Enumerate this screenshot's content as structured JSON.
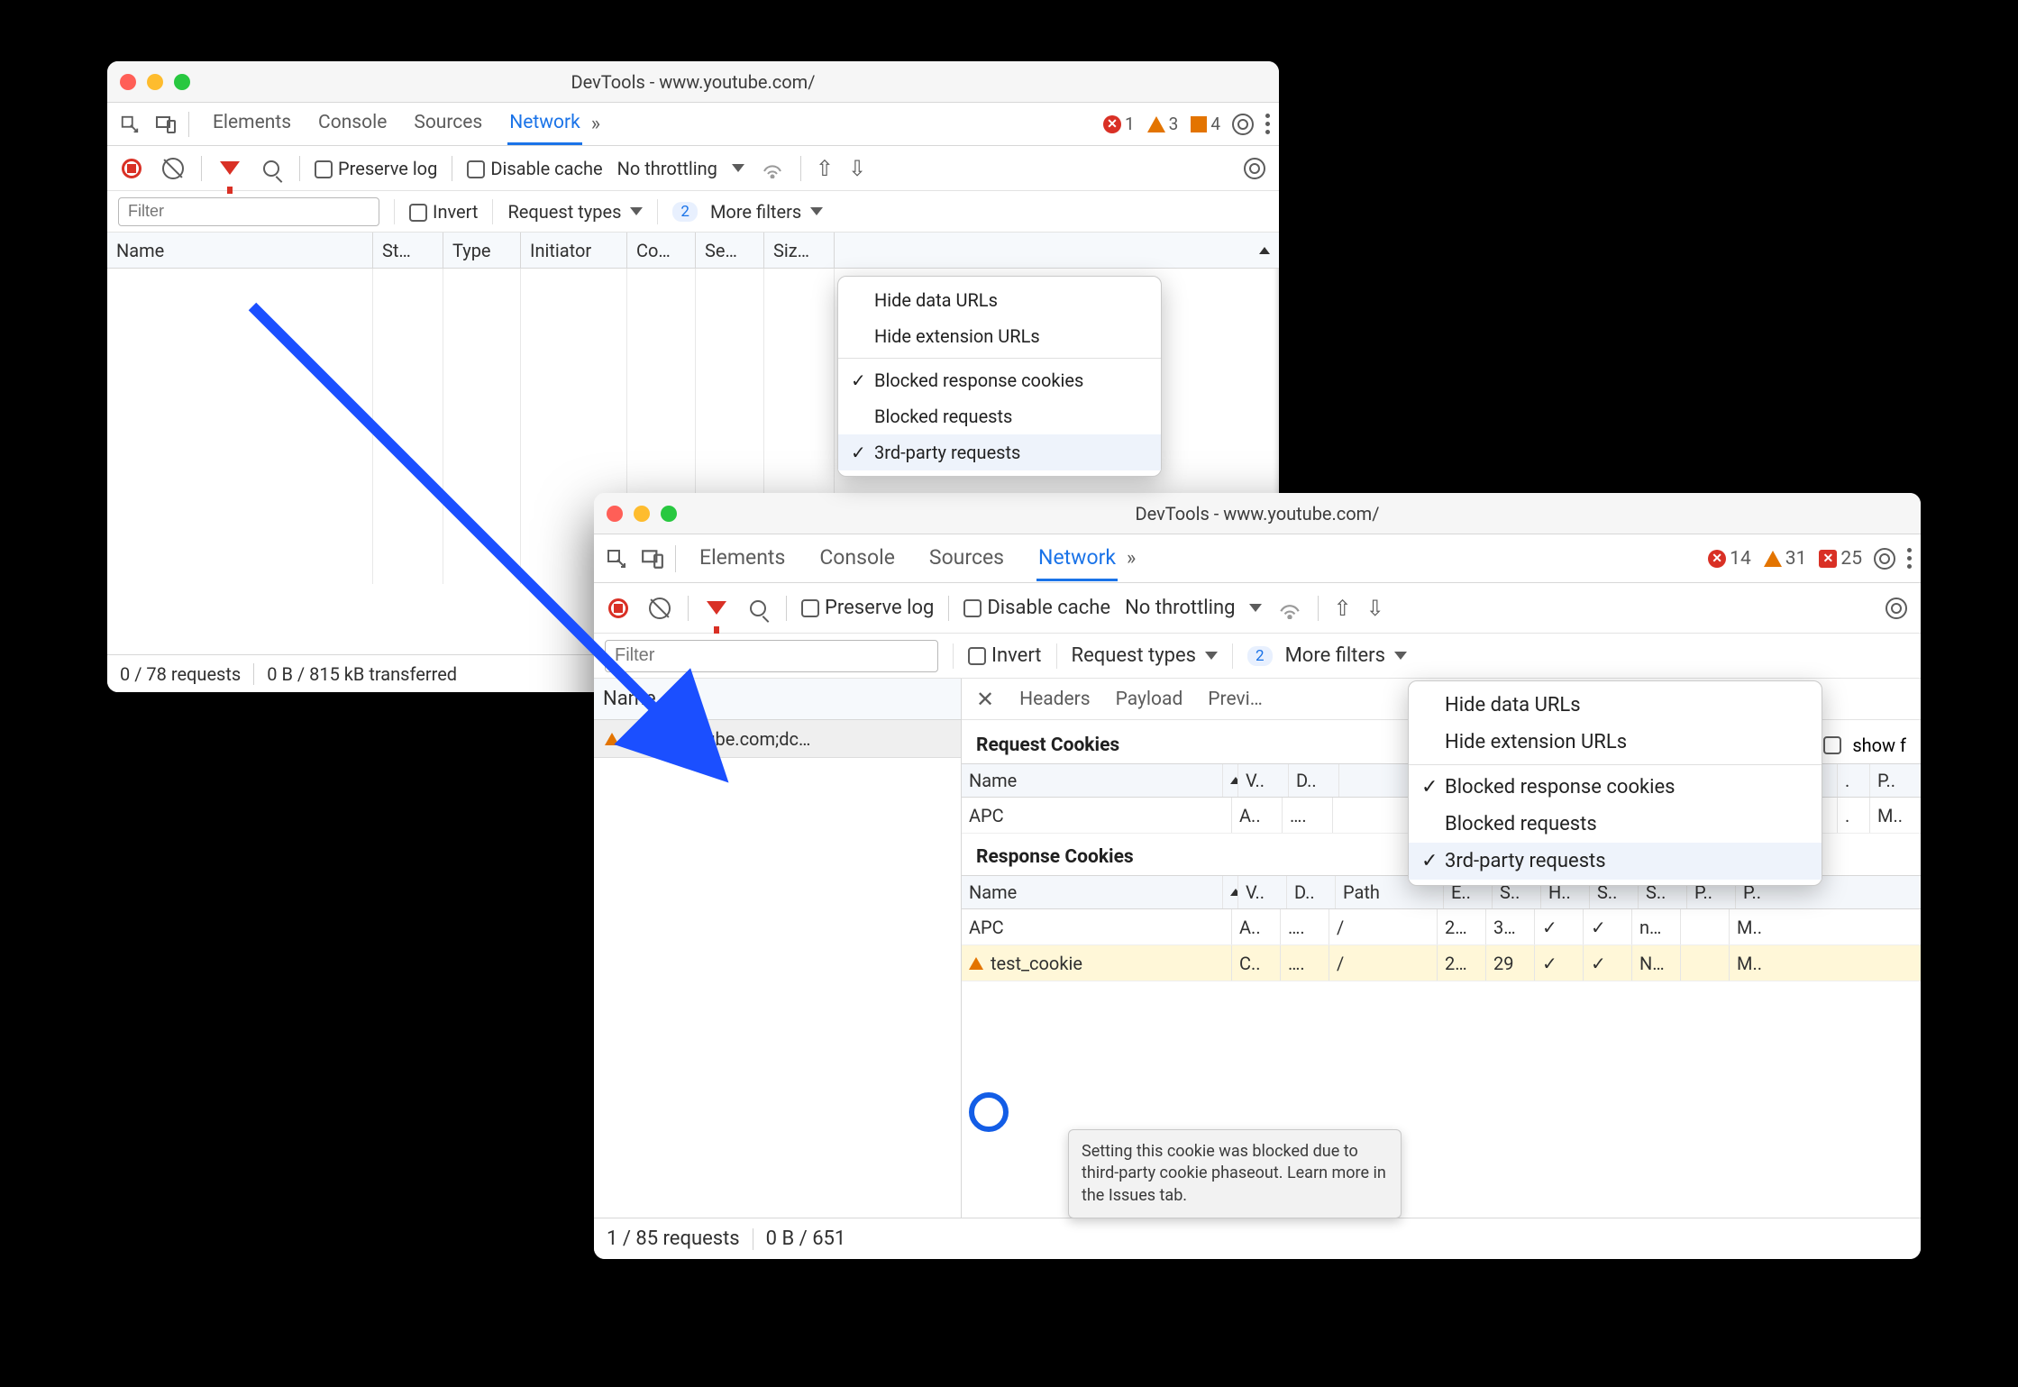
{
  "win1": {
    "title": "DevTools - www.youtube.com/",
    "tabs": [
      "Elements",
      "Console",
      "Sources",
      "Network"
    ],
    "activeTab": "Network",
    "errors": 1,
    "warnings": 3,
    "info": 4,
    "preserveLog": "Preserve log",
    "disableCache": "Disable cache",
    "throttling": "No throttling",
    "filterPlaceholder": "Filter",
    "invert": "Invert",
    "requestTypes": "Request types",
    "moreFiltersCount": "2",
    "moreFilters": "More filters",
    "columns": [
      "Name",
      "St…",
      "Type",
      "Initiator",
      "Co…",
      "Se…",
      "Siz…"
    ],
    "dropdown": {
      "hideData": "Hide data URLs",
      "hideExt": "Hide extension URLs",
      "blockedResp": "Blocked response cookies",
      "blockedReq": "Blocked requests",
      "thirdParty": "3rd-party requests"
    },
    "status": {
      "requests": "0 / 78 requests",
      "transferred": "0 B / 815 kB transferred"
    }
  },
  "win2": {
    "title": "DevTools - www.youtube.com/",
    "tabs": [
      "Elements",
      "Console",
      "Sources",
      "Network"
    ],
    "activeTab": "Network",
    "errors": 14,
    "warnings": 31,
    "info": 25,
    "preserveLog": "Preserve log",
    "disableCache": "Disable cache",
    "throttling": "No throttling",
    "filterPlaceholder": "Filter",
    "invert": "Invert",
    "requestTypes": "Request types",
    "moreFiltersCount": "2",
    "moreFilters": "More filters",
    "nameCol": "Name",
    "requestRow": "www.youtube.com;dc…",
    "detailTabs": [
      "Headers",
      "Payload",
      "Previ…"
    ],
    "requestCookiesTitle": "Request Cookies",
    "showFiltered": "show f",
    "reqCookieCols": [
      "Name",
      "V..",
      "D.."
    ],
    "reqCookieExtra": [
      ".",
      "P.."
    ],
    "reqCookieRows": [
      {
        "name": "APC",
        "v": "A..",
        "d": "…."
      }
    ],
    "reqCookieRowExtra": [
      ".",
      "M.."
    ],
    "responseCookiesTitle": "Response Cookies",
    "respCookieCols": [
      "Name",
      "V..",
      "D..",
      "Path",
      "E..",
      "S..",
      "H..",
      "S..",
      "S..",
      "P..",
      "P.."
    ],
    "respCookieRows": [
      {
        "name": "APC",
        "v": "A..",
        "d": "….",
        "path": "/",
        "e": "2…",
        "s1": "3…",
        "h": "✓",
        "s2": "✓",
        "s3": "n…",
        "p1": "",
        "p2": "M.."
      },
      {
        "name": "test_cookie",
        "v": "C..",
        "d": "….",
        "path": "/",
        "e": "2…",
        "s1": "29",
        "h": "✓",
        "s2": "✓",
        "s3": "N…",
        "p1": "",
        "p2": "M..",
        "warn": true
      }
    ],
    "tooltip": "Setting this cookie was blocked due to third-party cookie phaseout. Learn more in the Issues tab.",
    "dropdown": {
      "hideData": "Hide data URLs",
      "hideExt": "Hide extension URLs",
      "blockedResp": "Blocked response cookies",
      "blockedReq": "Blocked requests",
      "thirdParty": "3rd-party requests"
    },
    "status": {
      "requests": "1 / 85 requests",
      "transferred": "0 B / 651"
    }
  }
}
